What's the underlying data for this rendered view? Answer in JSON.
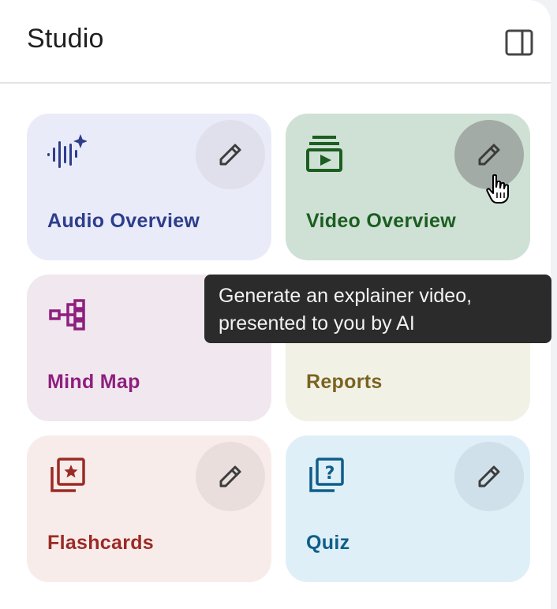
{
  "panel": {
    "title": "Studio",
    "collapse_icon": "side-panel-icon"
  },
  "cards": {
    "audio": {
      "label": "Audio Overview",
      "icon": "audio-sparkle-icon",
      "edit_icon": "pencil-icon"
    },
    "video": {
      "label": "Video Overview",
      "icon": "video-stack-icon",
      "edit_icon": "pencil-icon",
      "state": "hovered"
    },
    "mindmap": {
      "label": "Mind Map",
      "icon": "mind-map-icon"
    },
    "reports": {
      "label": "Reports"
    },
    "flashcards": {
      "label": "Flashcards",
      "icon": "flashcards-icon",
      "edit_icon": "pencil-icon"
    },
    "quiz": {
      "label": "Quiz",
      "icon": "quiz-icon",
      "edit_icon": "pencil-icon"
    }
  },
  "tooltip": {
    "line1": "Generate an explainer video,",
    "line2": "presented to you by AI"
  },
  "colors": {
    "audio_accent": "#2c3e8c",
    "video_accent": "#1b5e20",
    "mindmap_accent": "#8e1f7e",
    "reports_accent": "#7a6320",
    "flashcards_accent": "#9b2a25",
    "quiz_accent": "#0d5e8b"
  }
}
